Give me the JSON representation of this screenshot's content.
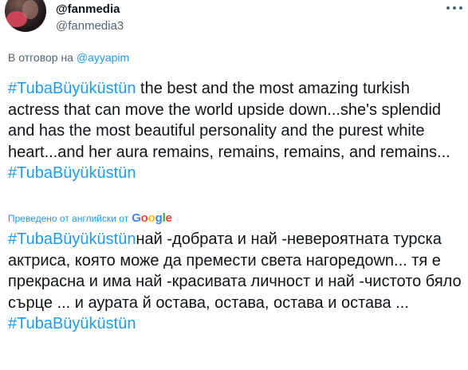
{
  "user": {
    "name": "@fanmedia",
    "handle": "@fanmedia3"
  },
  "reply": {
    "prefix": "В отговор на ",
    "to": "@ayyapim"
  },
  "tweet": {
    "hashtag": "#TubaBüyüküstün",
    "original_body": " the best and the most amazing turkish actress that can move the world upside down...she's splendid and has the most beautiful personality and the purest white heart...and her aura remains, remains, remains, and remains...",
    "translated_body": "най -добрата и най -невероятната турска актриса, която може да премести света нагоредown... тя е прекрасна и има най -красивата личност и най -чистото бяло сърце ... и аурата й остава, остава, остава и остава ..."
  },
  "translation": {
    "label": "Преведено от английски от",
    "logo_letters": [
      "G",
      "o",
      "o",
      "g",
      "l",
      "e"
    ]
  },
  "colors": {
    "accent": "#1d9bf0",
    "text": "#0f1419",
    "secondary": "#536471"
  },
  "icons": {
    "more": "more-horizontal-icon"
  }
}
